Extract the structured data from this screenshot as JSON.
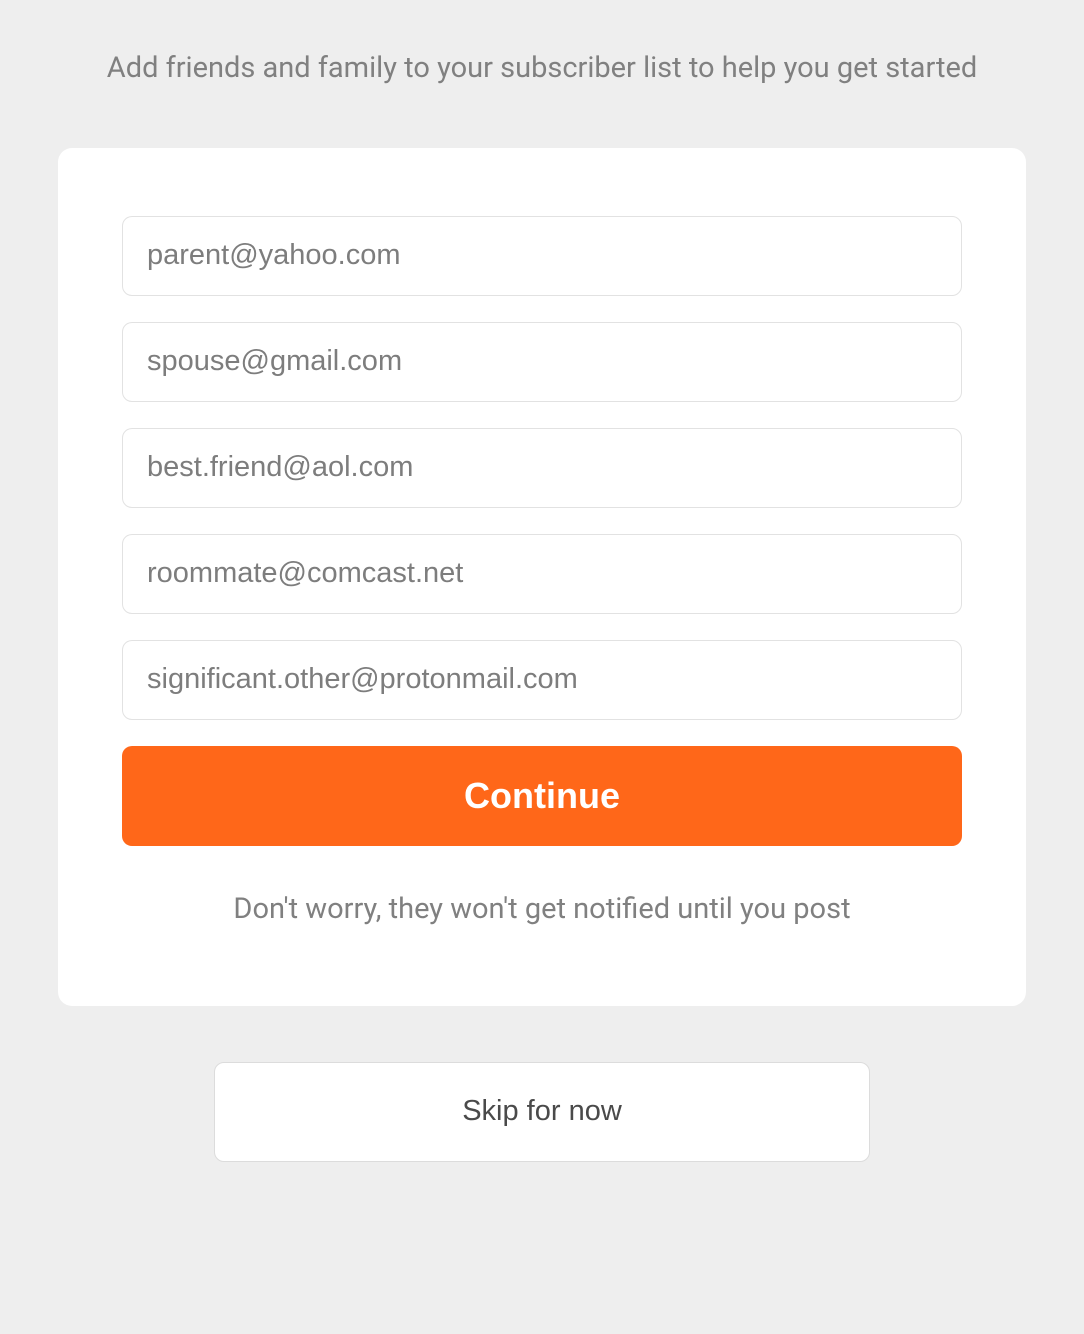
{
  "header": {
    "text": "Add friends and family to your subscriber list to help you get started"
  },
  "form": {
    "inputs": [
      {
        "placeholder": "parent@yahoo.com"
      },
      {
        "placeholder": "spouse@gmail.com"
      },
      {
        "placeholder": "best.friend@aol.com"
      },
      {
        "placeholder": "roommate@comcast.net"
      },
      {
        "placeholder": "significant.other@protonmail.com"
      }
    ],
    "continue_label": "Continue",
    "disclaimer": "Don't worry, they won't get notified until you post"
  },
  "skip_label": "Skip for now"
}
